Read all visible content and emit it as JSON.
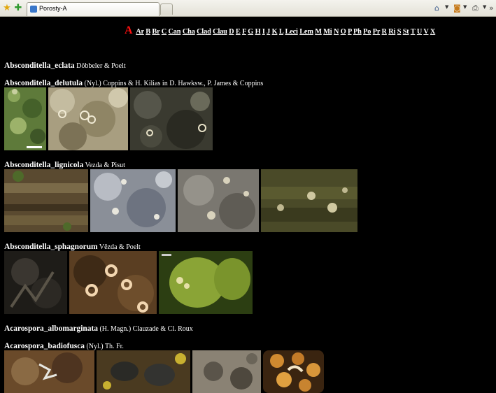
{
  "browser": {
    "tab_title": "Porosty-A"
  },
  "nav": {
    "current_letter": "A",
    "links": [
      "Ar",
      "B",
      "Br",
      "C",
      "Can",
      "Cha",
      "Clad",
      "Clau",
      "D",
      "E",
      "F",
      "G",
      "H",
      "I",
      "J",
      "K",
      "L",
      "Leci",
      "Lem",
      "M",
      "Mi",
      "N",
      "O",
      "P",
      "Ph",
      "Po",
      "Pr",
      "R",
      "Ri",
      "S",
      "St",
      "T",
      "U",
      "V",
      "X"
    ]
  },
  "species": [
    {
      "name": "Absconditella_eclata",
      "author": "Döbbeler & Poelt"
    },
    {
      "name": "Absconditella_delutula",
      "author": "(Nyl.) Coppins & H. Kilias in D. Hawksw., P. James & Coppins"
    },
    {
      "name": "Absconditella_lignicola",
      "author": "Vezda & Pisut"
    },
    {
      "name": "Absconditella_sphagnorum",
      "author": "Vězda & Poelt"
    },
    {
      "name": "Acarospora_albomarginata",
      "author": "(H. Magn.) Clauzade & Cl. Roux"
    },
    {
      "name": "Acarospora_badiofusca",
      "author": "(Nyl.) Th. Fr."
    }
  ]
}
